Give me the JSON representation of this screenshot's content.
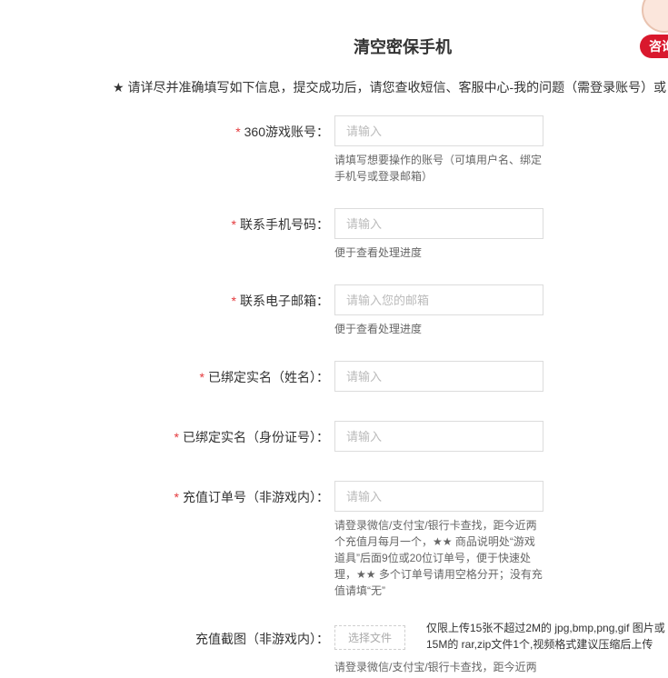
{
  "page_title": "清空密保手机",
  "notice": "★ 请详尽并准确填写如下信息，提交成功后，请您查收短信、客服中心-我的问题（需登录账号）或",
  "consult_button": "咨询",
  "form": {
    "account": {
      "label": "360游戏账号：",
      "placeholder": "请输入",
      "hint": "请填写想要操作的账号（可填用户名、绑定手机号或登录邮箱）"
    },
    "phone": {
      "label": "联系手机号码：",
      "placeholder": "请输入",
      "hint": "便于查看处理进度"
    },
    "email": {
      "label": "联系电子邮箱：",
      "placeholder": "请输入您的邮箱",
      "hint": "便于查看处理进度"
    },
    "realname": {
      "label": "已绑定实名（姓名）：",
      "placeholder": "请输入"
    },
    "idcard": {
      "label": "已绑定实名（身份证号）：",
      "placeholder": "请输入"
    },
    "order": {
      "label": "充值订单号（非游戏内）：",
      "placeholder": "请输入",
      "hint": "请登录微信/支付宝/银行卡查找，距今近两个充值月每月一个，★★ 商品说明处“游戏道具”后面9位或20位订单号，便于快速处理，★★ 多个订单号请用空格分开；没有充值请填“无”"
    },
    "screenshot": {
      "label": "充值截图（非游戏内）：",
      "button": "选择文件",
      "note_line1": "仅限上传15张不超过2M的 jpg,bmp,png,gif 图片或",
      "note_line2": "15M的 rar,zip文件1个,视频格式建议压缩后上传",
      "hint": "请登录微信/支付宝/银行卡查找，距今近两"
    },
    "required_mark": "*"
  }
}
